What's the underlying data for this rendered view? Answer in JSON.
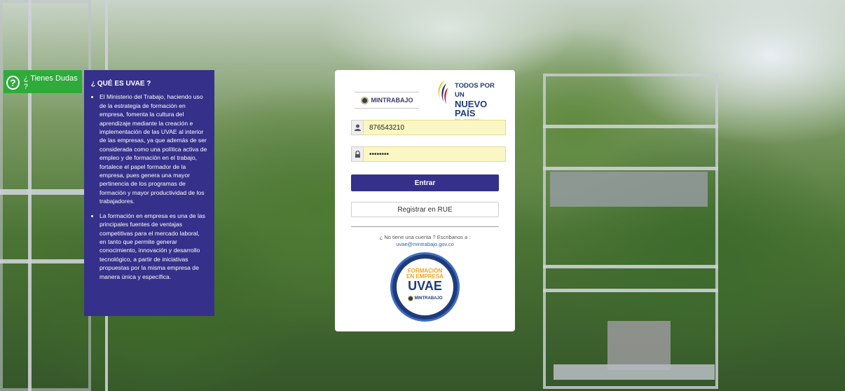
{
  "help": {
    "label": "¿ Tienes Dudas ?",
    "icon": "question-icon"
  },
  "info": {
    "title": "¿ QUÉ ES UVAE ?",
    "items": [
      "El Ministerio del Trabajo, haciendo uso de la estrategia de formación en empresa, fomenta la cultura del aprendizaje mediante la creación e implementación de las UVAE al interior de las empresas, ya que además de ser considerada como una política activa de empleo y de formación en el trabajo, fortalece el papel formador de la empresa, pues genera una mayor pertinencia de los programas de formación y mayor productividad de los trabajadores.",
      "La formación en empresa es una de las principales fuentes de ventajas competitivas para el mercado laboral, en tanto que permite generar conocimiento, innovación y desarrollo tecnológico, a partir de iniciativas propuestas por la misma empresa de manera única y específica."
    ]
  },
  "login": {
    "logo_mintrabajo": "MINTRABAJO",
    "logo_todos_line1": "TODOS POR UN",
    "logo_todos_line2": "NUEVO PAÍS",
    "logo_todos_line3": "PAZ · EQUIDAD · EDUCACIÓN",
    "username": "876543210",
    "password": "••••••••",
    "user_icon": "user-icon",
    "lock_icon": "lock-icon",
    "enter_label": "Entrar",
    "register_label": "Registrar en RUE",
    "no_account_text": "¿ No tiene una cuenta ? Escribanos a :",
    "contact_email": "uvae@mintrabajo.gov.co",
    "badge_line1": "FORMACIÓN",
    "badge_line2": "EN EMPRESA",
    "badge_line3": "UVAE",
    "badge_line4": "MINTRABAJO"
  },
  "colors": {
    "primary": "#35308a",
    "help_green": "#2eab3a",
    "input_fill": "#fbf7c4"
  }
}
